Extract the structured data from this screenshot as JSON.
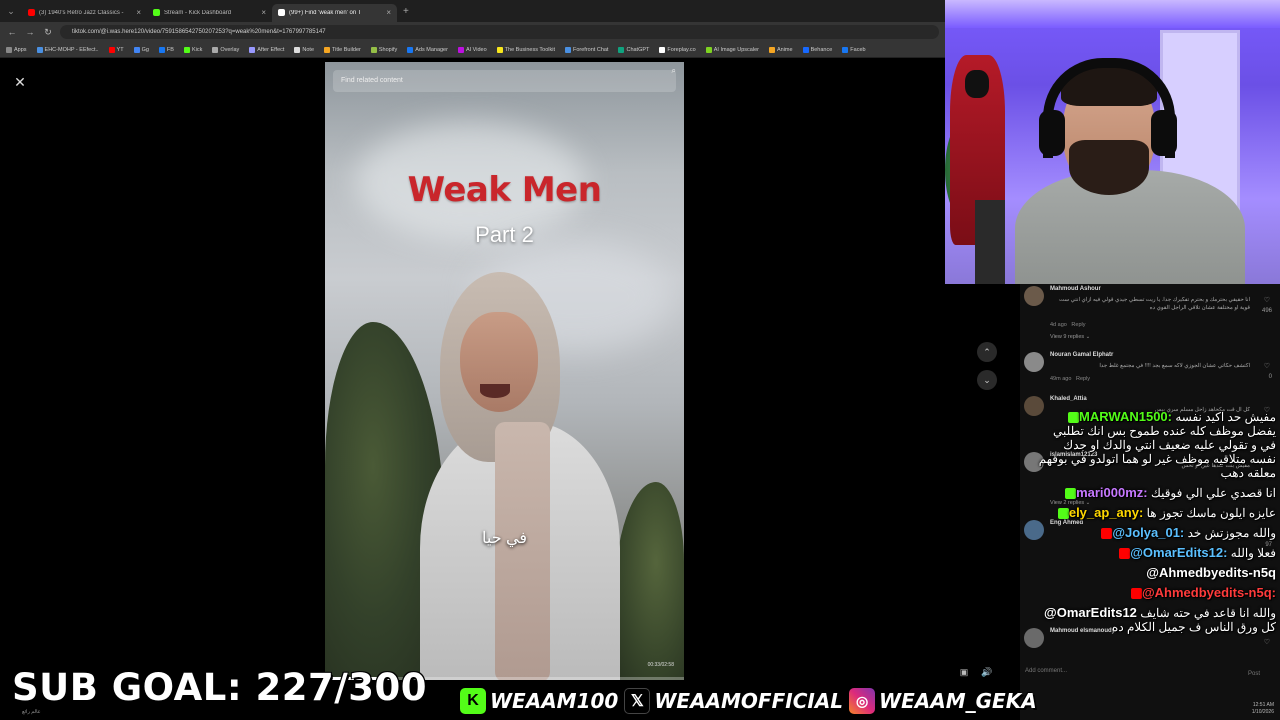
{
  "browser": {
    "tabs": [
      {
        "title": "(3) 1940's Retro Jazz Classics - ",
        "color": "#ff0000",
        "active": false
      },
      {
        "title": "Stream - Kick Dashboard",
        "color": "#53fc18",
        "active": false
      },
      {
        "title": "(99+) Find 'weak men' on T",
        "color": "#ffffff",
        "active": true
      }
    ],
    "url": "tiktok.com/@i.was.here120/video/7591586542750207253?q=weak%20men&t=1767997785147",
    "bookmarks": [
      {
        "label": "Apps",
        "color": "#888888"
      },
      {
        "label": "EHC-MOHP - EEfect..",
        "color": "#4a90e2"
      },
      {
        "label": "YT",
        "color": "#ff0000"
      },
      {
        "label": "Gg",
        "color": "#4285f4"
      },
      {
        "label": "FB",
        "color": "#1877f2"
      },
      {
        "label": "Kick",
        "color": "#53fc18"
      },
      {
        "label": "Overlay",
        "color": "#aaaaaa"
      },
      {
        "label": "After Effect",
        "color": "#9999ff"
      },
      {
        "label": "Note",
        "color": "#dddddd"
      },
      {
        "label": "Title Builder",
        "color": "#f5a623"
      },
      {
        "label": "Shopify",
        "color": "#95bf47"
      },
      {
        "label": "Ads Manager",
        "color": "#1877f2"
      },
      {
        "label": "AI Video",
        "color": "#bd10e0"
      },
      {
        "label": "The Business Toolkit",
        "color": "#f8e71c"
      },
      {
        "label": "Forefront Chat",
        "color": "#4a90e2"
      },
      {
        "label": "ChatGPT",
        "color": "#10a37f"
      },
      {
        "label": "Foreplay.co",
        "color": "#ffffff"
      },
      {
        "label": "AI Image Upscaler",
        "color": "#7ed321"
      },
      {
        "label": "Anime",
        "color": "#f5a623"
      },
      {
        "label": "Behance",
        "color": "#1769ff"
      },
      {
        "label": "Faceb",
        "color": "#1877f2"
      }
    ]
  },
  "video": {
    "search_placeholder": "Find related content",
    "title": "Weak Men",
    "subtitle": "Part 2",
    "caption": "في حيا",
    "timestamp": "00:33/02:58",
    "progress": 0.19
  },
  "comments": [
    {
      "user": "Mahmoud Ashour",
      "text": "انا حقيقي بحترمك و بحترم تفكيرك جدا. يا ريت تسطي جيدي قولي فيه ازاي انتي ست قوية او مختلفة عشان تلاقي الراجل القوي ده",
      "age": "4d ago",
      "reply": "Reply",
      "replies": "View 9 replies ⌄",
      "likes": "496",
      "avatar": "#6b5a4a"
    },
    {
      "user": "Nouran Gamal Elphatr",
      "text": "اكتشف حكاتي عشان الجوزي لاكه سمع بجد !!!! في مجتمع غلط جدا",
      "age": "49m ago",
      "reply": "Reply",
      "replies": "",
      "likes": "0",
      "avatar": "#8a8a8a"
    },
    {
      "user": "Khaled_Attia",
      "text": "كل ال قت مكحاهد زاحل مسلم سري بيس",
      "age": "",
      "reply": "",
      "replies": "",
      "likes": "",
      "avatar": "#5a4a3a"
    },
    {
      "user": "islamislam12123",
      "text": "مفيش بنت عندها عين او تحس",
      "age": "",
      "reply": "",
      "replies": "View 2 replies ⌄",
      "likes": "53",
      "avatar": "#777777"
    },
    {
      "user": "Eng Ahmed",
      "text": "",
      "age": "",
      "reply": "",
      "replies": "",
      "likes": "97",
      "avatar": "#4a6a8a"
    },
    {
      "user": "Mahmoud elsmanoudy",
      "text": "",
      "age": "",
      "reply": "",
      "replies": "",
      "likes": "",
      "avatar": "#6a6a6a"
    }
  ],
  "add_comment": "Add comment...",
  "post_label": "Post",
  "chat": [
    {
      "platform": "kick",
      "user": "MARWAN1500:",
      "user_color": "#53fc18",
      "text": "مفيش حد اكيد نفسه يفضل موظف كله عنده طموح بس انك تطلبي في و تقولي عليه ضعيف انتي والدك او جدك نفسه متلاقيه موظف غير لو هما اتولدو في بوقهم معلقه دهب"
    },
    {
      "platform": "kick",
      "user": "mari000mz:",
      "user_color": "#c678ff",
      "text": "انا قصدي علي الي فوقيك"
    },
    {
      "platform": "kick",
      "user": "ely_ap_any:",
      "user_color": "#ffd700",
      "text": "عايزه ايلون ماسك تجوز ها"
    },
    {
      "platform": "yt",
      "user": "@Jolya_01:",
      "user_color": "#5bc0ff",
      "text": "والله مجوزتش خد"
    },
    {
      "platform": "yt",
      "user": "@OmarEdits12:",
      "user_color": "#5bc0ff",
      "text": "فعلا والله"
    },
    {
      "platform": "none",
      "user": "@Ahmedbyedits-n5q",
      "user_color": "#ffffff",
      "text": ""
    },
    {
      "platform": "yt",
      "user": "@Ahmedbyedits-n5q:",
      "user_color": "#ff3b3b",
      "text": ""
    },
    {
      "platform": "none",
      "user": "@OmarEdits12",
      "user_color": "#ffffff",
      "text": "والله انا قاعد في حته شايف كل ورق الناس ف جميل الكلام ده"
    }
  ],
  "overlay": {
    "sub_goal": "SUB GOAL: 227/300",
    "kick_handle": "WEAAM100",
    "x_handle": "WEAAMOFFICIAL",
    "ig_handle": "WEAAM_GEKA",
    "kick_icon": "K",
    "x_icon": "𝕏",
    "ig_icon": "◎"
  },
  "taskbar": {
    "left_text": "عالم رائع",
    "clock": "12:51 AM",
    "date": "1/10/2026"
  }
}
